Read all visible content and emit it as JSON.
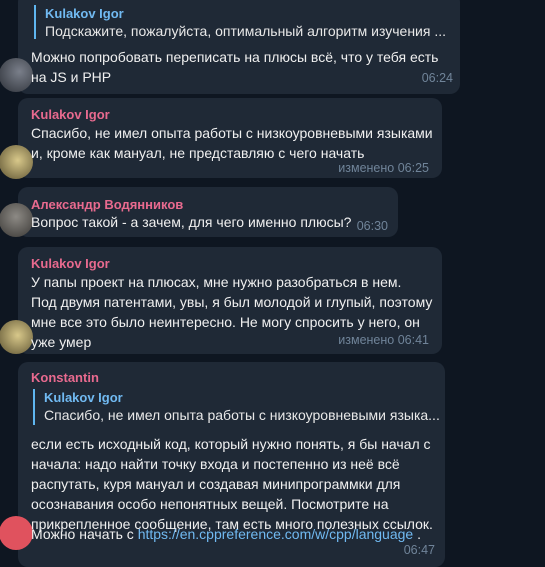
{
  "messages": [
    {
      "sender": "",
      "reply": {
        "name": "Kulakov Igor",
        "text": "Подскажите, пожалуйста, оптимальный алгоритм изучения ..."
      },
      "text": "Можно попробовать переписать на плюсы всё, что у тебя есть\nна JS и PHP",
      "time": "06:24"
    },
    {
      "sender": "Kulakov Igor",
      "text": "Спасибо, не имел опыта работы с низкоуровневыми языками\nи, кроме как мануал, не представляю с чего начать",
      "time": "изменено 06:25"
    },
    {
      "sender": "Александр Водянников",
      "text": "Вопрос такой - а зачем, для чего именно плюсы?",
      "time": "06:30"
    },
    {
      "sender": "Kulakov Igor",
      "text": "У папы проект на плюсах, мне нужно разобраться в нем.\nПод двумя патентами, увы, я был молодой и глупый, поэтому\nмне все это было неинтересно.  Не могу спросить у него, он\nуже умер",
      "time": "изменено 06:41"
    },
    {
      "sender": "Konstantin",
      "reply": {
        "name": "Kulakov Igor",
        "text": "Спасибо, не имел опыта работы с низкоуровневыми языка..."
      },
      "text": "если есть исходный код, который нужно понять, я бы начал с\nначала: надо найти точку входа и постепенно из неё всё\nраспутать, куря мануал и создавая минипрограммки для\nосознавания особо непонятных вещей. Посмотрите на\nприкрепленное сообщение, там есть много полезных ссылок.",
      "text_last_prefix": "Можно начать с ",
      "link": "https://en.cppreference.com/w/cpp/language",
      "text_last_suffix": " .",
      "time": "06:47"
    }
  ],
  "colors": {
    "background": "#0e1621",
    "bubble": "#1f2936",
    "sender_pink": "#e86a8f",
    "link": "#71baf2",
    "meta": "#708499"
  }
}
